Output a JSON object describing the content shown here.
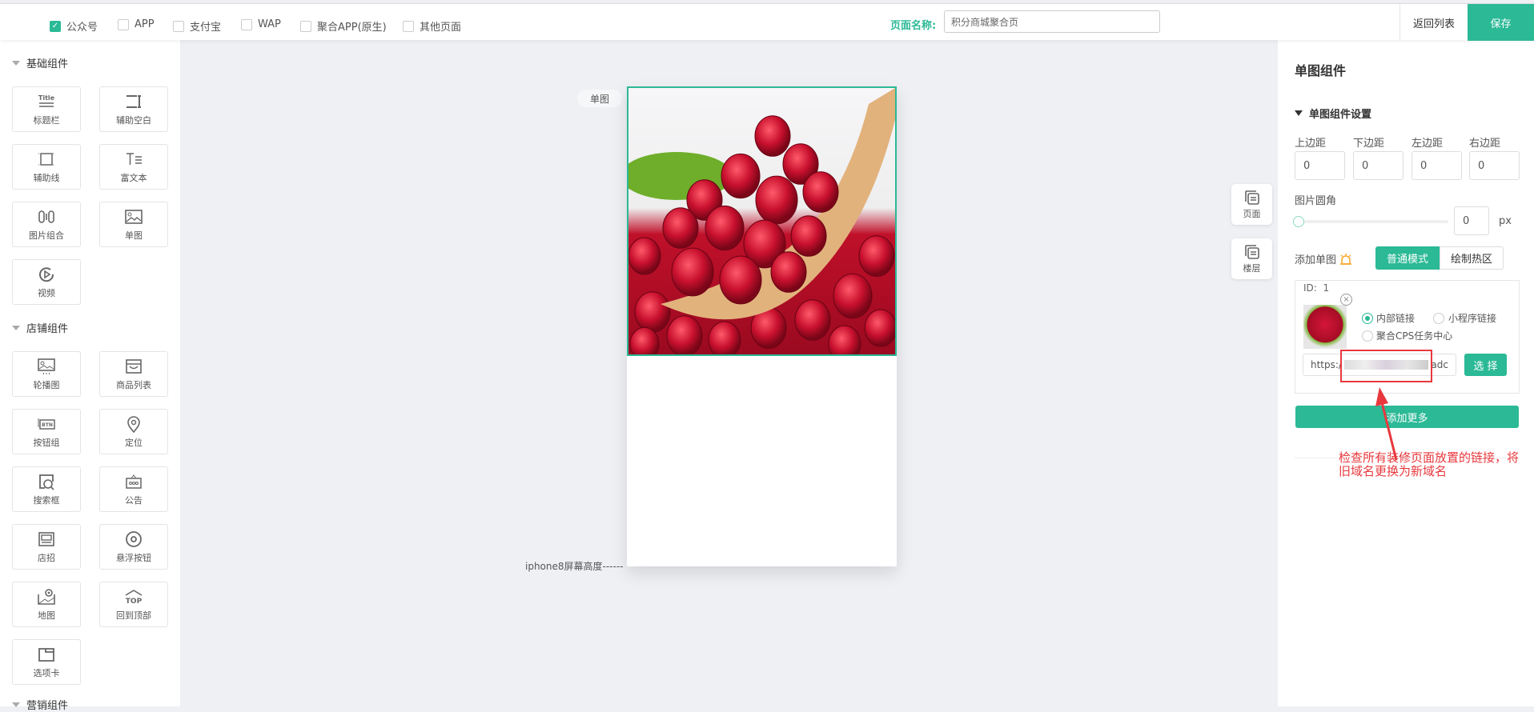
{
  "topbar": {
    "platforms": [
      {
        "label": "公众号",
        "checked": true
      },
      {
        "label": "APP",
        "checked": false
      },
      {
        "label": "支付宝",
        "checked": false
      },
      {
        "label": "WAP",
        "checked": false
      },
      {
        "label": "聚合APP(原生)",
        "checked": false
      },
      {
        "label": "其他页面",
        "checked": false
      }
    ],
    "page_name_label": "页面名称:",
    "page_name_value": "积分商城聚合页",
    "back_label": "返回列表",
    "save_label": "保存"
  },
  "sidebar": {
    "sections": [
      {
        "title": "基础组件",
        "items": [
          "标题栏",
          "辅助空白",
          "辅助线",
          "富文本",
          "图片组合",
          "单图",
          "视频"
        ]
      },
      {
        "title": "店铺组件",
        "items": [
          "轮播图",
          "商品列表",
          "按钮组",
          "定位",
          "搜索框",
          "公告",
          "店招",
          "悬浮按钮",
          "地图",
          "回到顶部",
          "选项卡"
        ]
      },
      {
        "title": "营销组件",
        "items": []
      }
    ]
  },
  "canvas": {
    "component_tag": "单图",
    "screen_marker": "iphone8屏幕高度------",
    "float_buttons": [
      {
        "label": "页面",
        "icon": "page-icon"
      },
      {
        "label": "楼层",
        "icon": "layers-icon"
      }
    ]
  },
  "panel": {
    "title": "单图组件",
    "section": "单图组件设置",
    "margins": [
      {
        "label": "上边距",
        "value": "0"
      },
      {
        "label": "下边距",
        "value": "0"
      },
      {
        "label": "左边距",
        "value": "0"
      },
      {
        "label": "右边距",
        "value": "0"
      }
    ],
    "radius_label": "图片圆角",
    "radius_value": "0",
    "radius_unit": "px",
    "radius_slider": 0,
    "add_label": "添加单图",
    "modes": [
      {
        "label": "普通模式",
        "active": true
      },
      {
        "label": "绘制热区",
        "active": false
      }
    ],
    "item": {
      "id_label": "ID:",
      "id_value": "1",
      "link_types": [
        {
          "label": "内部链接",
          "checked": true
        },
        {
          "label": "小程序链接",
          "checked": false
        },
        {
          "label": "聚合CPS任务中心",
          "checked": false
        }
      ],
      "url_start": "https:/",
      "url_end": "adc",
      "select_label": "选 择"
    },
    "add_more_label": "添加更多",
    "annotation": [
      "检查所有装修页面放置的链接，将",
      "旧域名更换为新域名"
    ]
  },
  "colors": {
    "accent": "#2bb996",
    "annotation": "#e8383d",
    "canvas_bg": "#eef0f4"
  }
}
